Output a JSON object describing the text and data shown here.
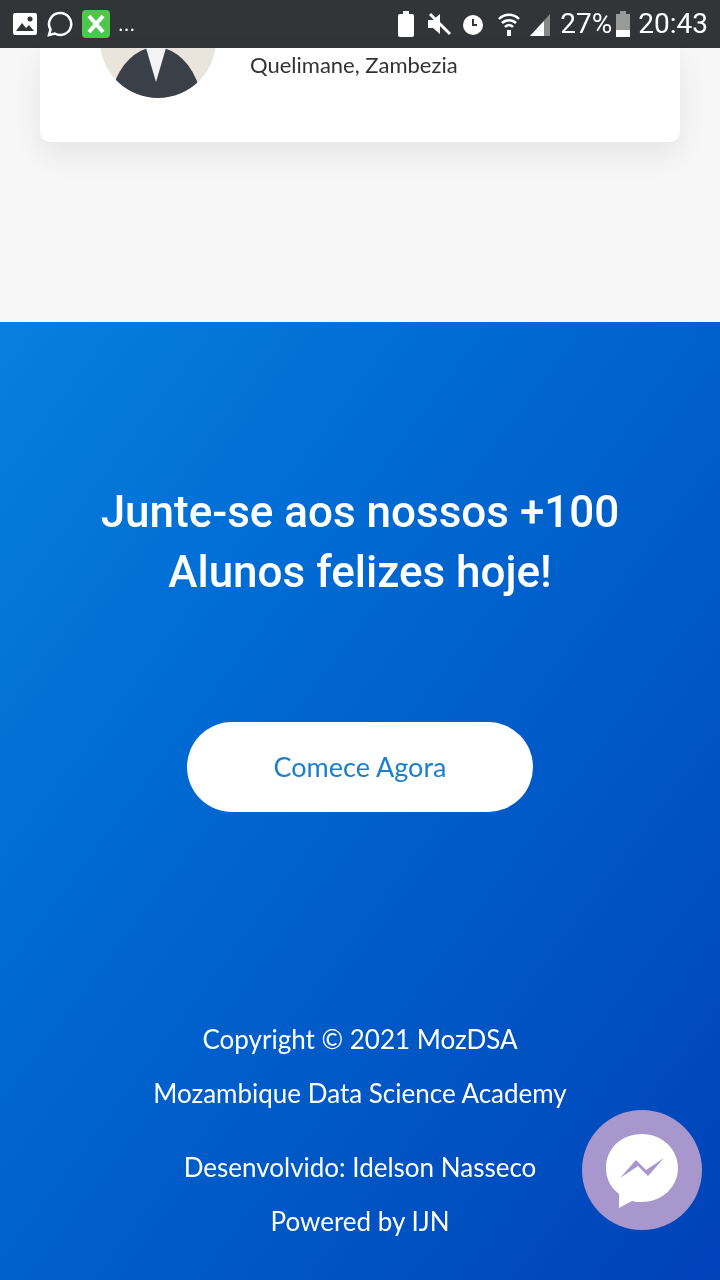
{
  "status_bar": {
    "notification_more": "...",
    "battery": "27%",
    "time": "20:43"
  },
  "profile_card": {
    "location": "Quelimane, Zambezia"
  },
  "cta": {
    "heading": "Junte-se aos nossos +100 Alunos felizes hoje!",
    "button": "Comece Agora"
  },
  "footer": {
    "lines": [
      "Copyright © 2021 MozDSA",
      "Mozambique Data Science Academy",
      "Desenvolvido: Idelson Nasseco",
      "Powered by IJN"
    ]
  }
}
